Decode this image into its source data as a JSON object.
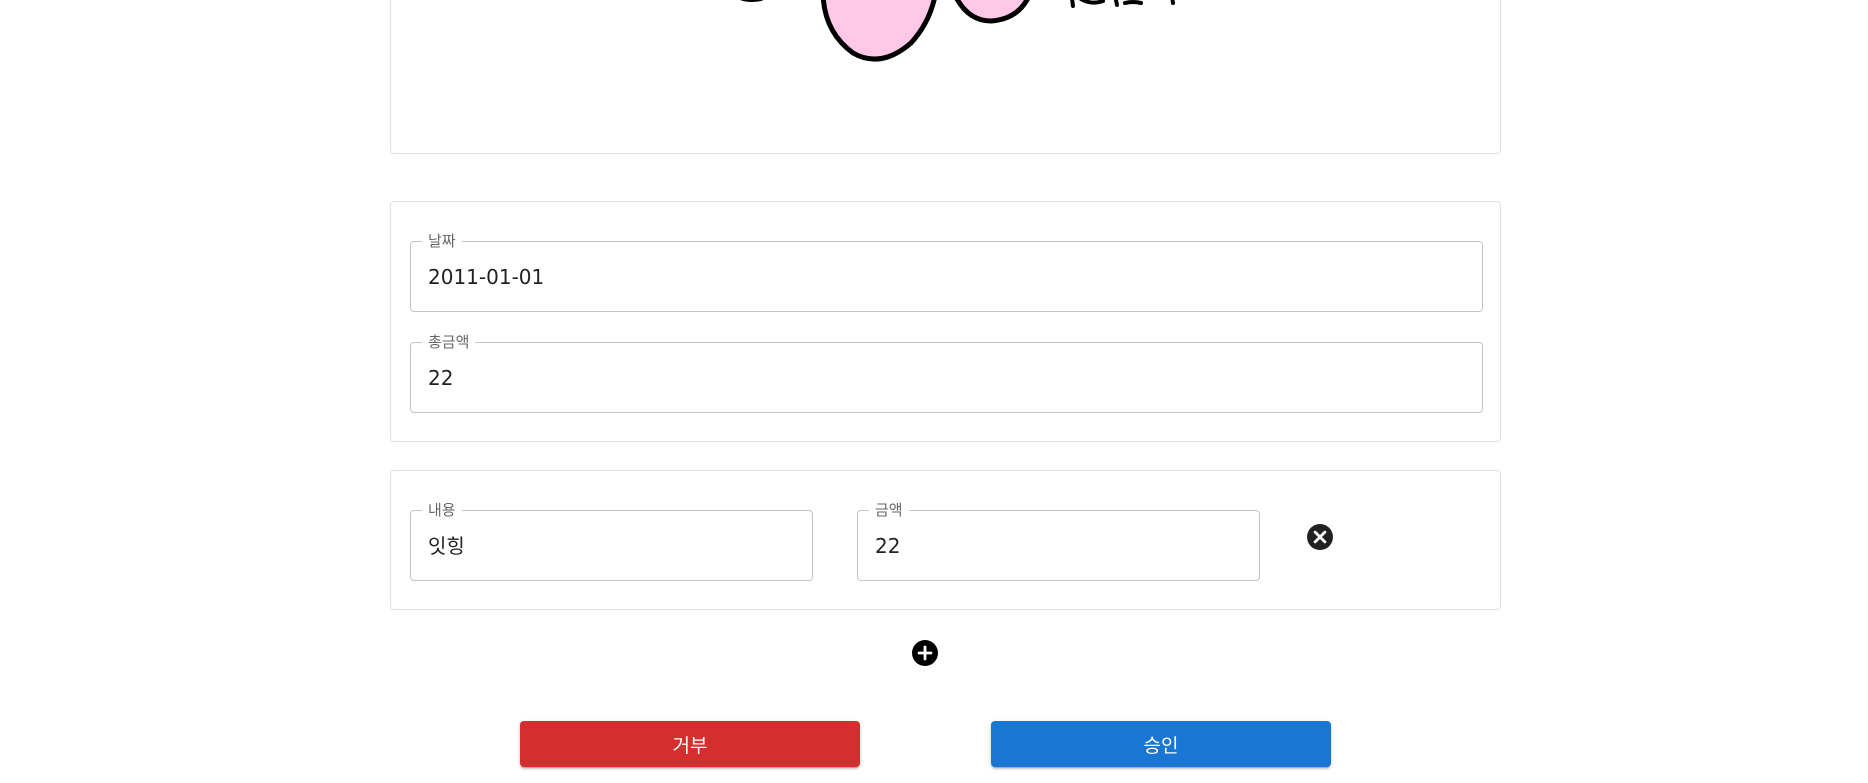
{
  "receipt_form": {
    "date": {
      "label": "날짜",
      "value": "2011-01-01"
    },
    "total": {
      "label": "총금액",
      "value": "22"
    }
  },
  "items": [
    {
      "description": {
        "label": "내용",
        "value": "잇힝"
      },
      "amount": {
        "label": "금액",
        "value": "22"
      },
      "remove_icon": "close-circle-icon"
    }
  ],
  "add_item_icon": "plus-circle-icon",
  "actions": {
    "reject_label": "거부",
    "approve_label": "승인"
  },
  "colors": {
    "reject": "#d32f2f",
    "approve": "#1976d2",
    "sketch_fill": "#ffc8e6"
  }
}
